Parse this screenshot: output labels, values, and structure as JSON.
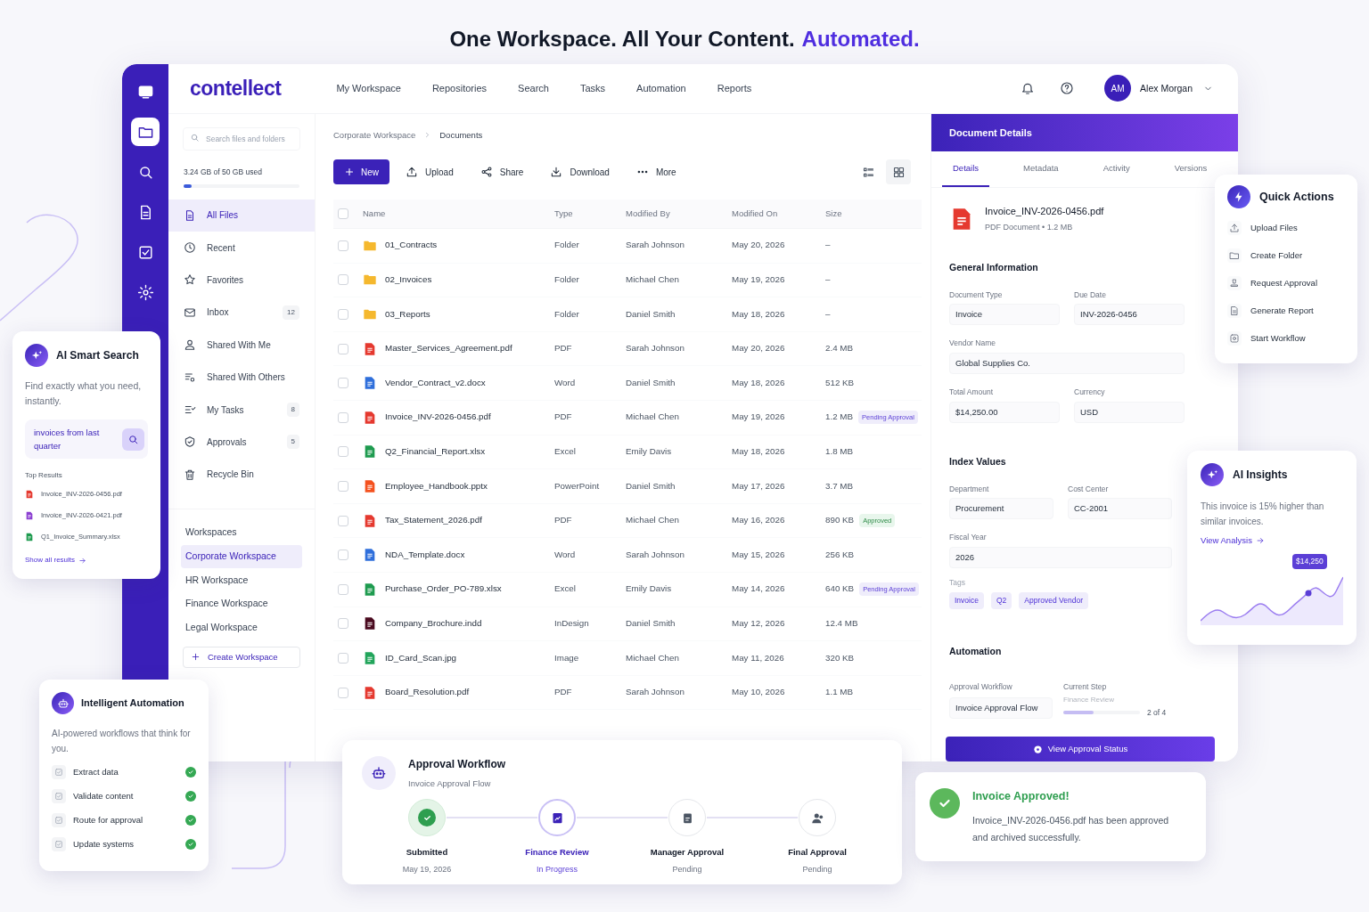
{
  "headline": {
    "main": "One Workspace. All Your Content.",
    "accent": "Automated."
  },
  "rail": [
    {
      "kind": "monitor",
      "selected": false
    },
    {
      "kind": "folder",
      "selected": true
    },
    {
      "kind": "search",
      "selected": false
    },
    {
      "kind": "document",
      "selected": false
    },
    {
      "kind": "checkbox",
      "selected": false
    },
    {
      "kind": "gear",
      "selected": false
    }
  ],
  "brand": "contellect",
  "nav": [
    "My Workspace",
    "Repositories",
    "Search",
    "Tasks",
    "Automation",
    "Reports"
  ],
  "user": {
    "initials": "AM",
    "name": "Alex Morgan"
  },
  "sidebar": {
    "search_placeholder": "Search files and folders",
    "storage": {
      "label": "3.24 GB of 50 GB used",
      "level": 0.07
    },
    "items": [
      {
        "kind": "files",
        "label": "All Files",
        "selected": true
      },
      {
        "kind": "recent",
        "label": "Recent",
        "selected": false
      },
      {
        "kind": "favorites",
        "label": "Favorites",
        "selected": false
      },
      {
        "kind": "inbox",
        "label": "Inbox",
        "count": "12",
        "selected": false
      },
      {
        "kind": "shared_me",
        "label": "Shared With Me",
        "selected": false
      },
      {
        "kind": "shared_others",
        "label": "Shared With Others",
        "selected": false
      },
      {
        "kind": "tasks",
        "label": "My Tasks",
        "count": "8",
        "selected": false
      },
      {
        "kind": "approvals",
        "label": "Approvals",
        "count": "5",
        "selected": false
      },
      {
        "kind": "recycle",
        "label": "Recycle Bin",
        "selected": false
      }
    ],
    "workspaces_heading": "Workspaces",
    "workspaces": [
      {
        "label": "Corporate Workspace",
        "selected": true
      },
      {
        "label": "HR Workspace",
        "selected": false
      },
      {
        "label": "Finance Workspace",
        "selected": false
      },
      {
        "label": "Legal Workspace",
        "selected": false
      }
    ],
    "create_workspace": "Create Workspace"
  },
  "breadcrumb": [
    "Corporate Workspace",
    "Documents"
  ],
  "toolbar": {
    "new": "New",
    "actions": [
      {
        "kind": "upload",
        "label": "Upload"
      },
      {
        "kind": "share",
        "label": "Share"
      },
      {
        "kind": "download",
        "label": "Download"
      },
      {
        "kind": "more",
        "label": "More"
      }
    ],
    "views": [
      {
        "kind": "list",
        "selected": false
      },
      {
        "kind": "grid",
        "selected": true
      }
    ]
  },
  "table": {
    "columns": [
      "Name",
      "Type",
      "Modified By",
      "Modified On",
      "Size"
    ],
    "header_checked": false,
    "rows": [
      {
        "kind": "folder",
        "name": "01_Contracts",
        "type": "Folder",
        "modified_by": "Sarah Johnson",
        "modified_on": "May 20, 2026",
        "size": "–",
        "checked": false
      },
      {
        "kind": "folder",
        "name": "02_Invoices",
        "type": "Folder",
        "modified_by": "Michael Chen",
        "modified_on": "May 19, 2026",
        "size": "–",
        "checked": false
      },
      {
        "kind": "folder",
        "name": "03_Reports",
        "type": "Folder",
        "modified_by": "Daniel Smith",
        "modified_on": "May 18, 2026",
        "size": "–",
        "checked": false
      },
      {
        "kind": "pdf",
        "name": "Master_Services_Agreement.pdf",
        "type": "PDF",
        "modified_by": "Sarah Johnson",
        "modified_on": "May 20, 2026",
        "size": "2.4 MB",
        "checked": false
      },
      {
        "kind": "word",
        "name": "Vendor_Contract_v2.docx",
        "type": "Word",
        "modified_by": "Daniel Smith",
        "modified_on": "May 18, 2026",
        "size": "512 KB",
        "checked": false
      },
      {
        "kind": "pdf",
        "name": "Invoice_INV-2026-0456.pdf",
        "type": "PDF",
        "modified_by": "Michael Chen",
        "modified_on": "May 19, 2026",
        "size": "1.2 MB",
        "checked": false,
        "badge": {
          "kind": "pending",
          "label": "Pending Approval"
        }
      },
      {
        "kind": "excel",
        "name": "Q2_Financial_Report.xlsx",
        "type": "Excel",
        "modified_by": "Emily Davis",
        "modified_on": "May 18, 2026",
        "size": "1.8 MB",
        "checked": false
      },
      {
        "kind": "powerpoint",
        "name": "Employee_Handbook.pptx",
        "type": "PowerPoint",
        "modified_by": "Daniel Smith",
        "modified_on": "May 17, 2026",
        "size": "3.7 MB",
        "checked": false
      },
      {
        "kind": "pdf",
        "name": "Tax_Statement_2026.pdf",
        "type": "PDF",
        "modified_by": "Michael Chen",
        "modified_on": "May 16, 2026",
        "size": "890 KB",
        "checked": false,
        "badge": {
          "kind": "approved",
          "label": "Approved"
        }
      },
      {
        "kind": "word",
        "name": "NDA_Template.docx",
        "type": "Word",
        "modified_by": "Sarah Johnson",
        "modified_on": "May 15, 2026",
        "size": "256 KB",
        "checked": false
      },
      {
        "kind": "excel",
        "name": "Purchase_Order_PO-789.xlsx",
        "type": "Excel",
        "modified_by": "Emily Davis",
        "modified_on": "May 14, 2026",
        "size": "640 KB",
        "checked": false,
        "badge": {
          "kind": "pending",
          "label": "Pending Approval"
        }
      },
      {
        "kind": "indesign",
        "name": "Company_Brochure.indd",
        "type": "InDesign",
        "modified_by": "Daniel Smith",
        "modified_on": "May 12, 2026",
        "size": "12.4 MB",
        "checked": false
      },
      {
        "kind": "image",
        "name": "ID_Card_Scan.jpg",
        "type": "Image",
        "modified_by": "Michael Chen",
        "modified_on": "May 11, 2026",
        "size": "320 KB",
        "checked": false
      },
      {
        "kind": "pdf",
        "name": "Board_Resolution.pdf",
        "type": "PDF",
        "modified_by": "Sarah Johnson",
        "modified_on": "May 10, 2026",
        "size": "1.1 MB",
        "checked": false
      }
    ]
  },
  "details": {
    "title": "Document Details",
    "tabs": [
      {
        "label": "Details",
        "selected": true
      },
      {
        "label": "Metadata",
        "selected": false
      },
      {
        "label": "Activity",
        "selected": false
      },
      {
        "label": "Versions",
        "selected": false
      }
    ],
    "file": {
      "kind": "pdf",
      "name": "Invoice_INV-2026-0456.pdf",
      "meta": "PDF Document • 1.2 MB"
    },
    "general": {
      "heading": "General Information",
      "rows": [
        [
          {
            "label": "Document Type",
            "value": "Invoice"
          },
          {
            "label": "Due Date",
            "value": "INV-2026-0456"
          }
        ],
        [
          {
            "label": "Vendor Name",
            "value": "Global Supplies Co."
          }
        ],
        [
          {
            "label": "Total Amount",
            "value": "$14,250.00"
          },
          {
            "label": "Currency",
            "value": "USD"
          }
        ]
      ]
    },
    "index": {
      "heading": "Index Values",
      "rows": [
        [
          {
            "label": "Department",
            "value": "Procurement"
          },
          {
            "label": "Cost Center",
            "value": "CC-2001"
          }
        ],
        [
          {
            "label": "Fiscal Year",
            "value": "2026"
          }
        ]
      ],
      "tags_label": "Tags",
      "tags": [
        "Invoice",
        "Q2",
        "Approved Vendor"
      ]
    },
    "automation": {
      "heading": "Automation",
      "workflow_label": "Approval Workflow",
      "workflow_value": "Invoice Approval Flow",
      "step_label": "Current Step",
      "step_value": "Finance Review",
      "level": 0.4,
      "step_count": "2 of 4"
    },
    "button": "View Approval Status"
  },
  "smart_search": {
    "title": "AI Smart Search",
    "text": "Find exactly what you need, instantly.",
    "query": "invoices from last quarter",
    "results_heading": "Top Results",
    "results": [
      {
        "kind": "pdf",
        "name": "Invoice_INV-2026-0456.pdf"
      },
      {
        "kind": "document",
        "name": "Invoice_INV-2026-0421.pdf"
      },
      {
        "kind": "excel",
        "name": "Q1_Invoice_Summary.xlsx"
      }
    ],
    "show_all": "Show all results"
  },
  "automation_card": {
    "title": "Intelligent Automation",
    "text": "AI-powered workflows that think for you.",
    "steps": [
      {
        "label": "Extract data",
        "done": true
      },
      {
        "label": "Validate content",
        "done": true
      },
      {
        "label": "Route for approval",
        "done": true
      },
      {
        "label": "Update systems",
        "done": true
      }
    ]
  },
  "approval_workflow": {
    "title": "Approval Workflow",
    "subtitle": "Invoice Approval Flow",
    "steps": [
      {
        "kind": "check",
        "label": "Submitted",
        "note": "May 19, 2026",
        "done": true,
        "active": false
      },
      {
        "kind": "chart",
        "label": "Finance Review",
        "note": "In Progress",
        "done": false,
        "active": true
      },
      {
        "kind": "clipboard",
        "label": "Manager Approval",
        "note": "Pending",
        "done": false,
        "active": false
      },
      {
        "kind": "people",
        "label": "Final Approval",
        "note": "Pending",
        "done": false,
        "active": false
      }
    ]
  },
  "quick_actions": {
    "title": "Quick Actions",
    "items": [
      {
        "kind": "upload",
        "label": "Upload Files"
      },
      {
        "kind": "folder",
        "label": "Create Folder"
      },
      {
        "kind": "stamp",
        "label": "Request Approval"
      },
      {
        "kind": "report",
        "label": "Generate Report"
      },
      {
        "kind": "workflow",
        "label": "Start Workflow"
      }
    ]
  },
  "ai_insights": {
    "title": "AI Insights",
    "text": "This invoice is 15% higher than similar invoices.",
    "link": "View Analysis",
    "tooltip": "$14,250"
  },
  "toast": {
    "title": "Invoice Approved!",
    "text": "Invoice_INV-2026-0456.pdf has been approved and archived successfully."
  }
}
